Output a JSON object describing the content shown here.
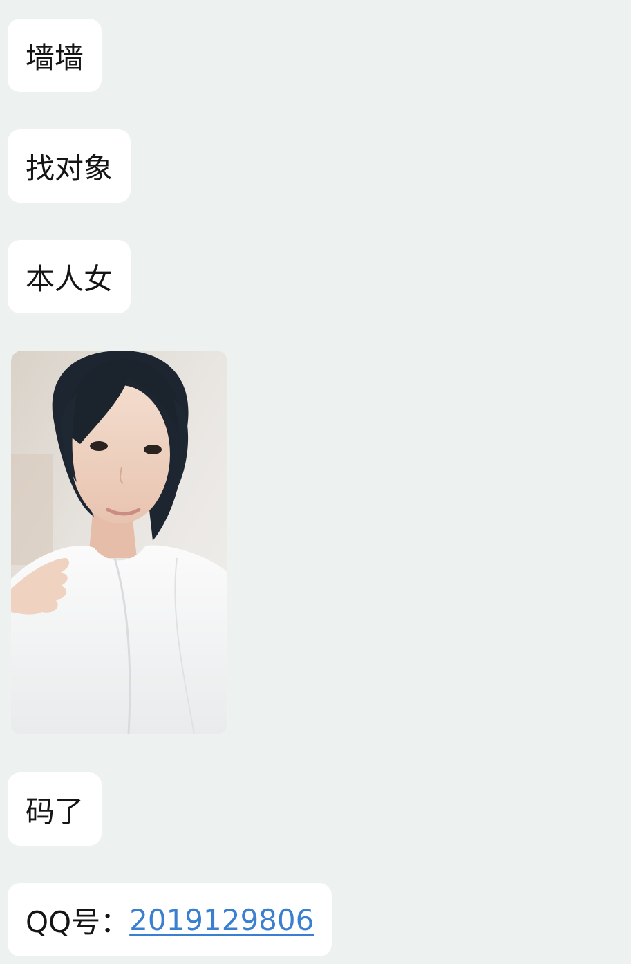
{
  "messages": [
    {
      "text": "墙墙"
    },
    {
      "text": "找对象"
    },
    {
      "text": "本人女"
    },
    {
      "text": "码了"
    }
  ],
  "qq": {
    "label": "QQ号：",
    "number": "2019129806",
    "link_color": "#3b7fd1"
  },
  "photo": {
    "icon": "photo-of-person"
  },
  "theme": {
    "background": "#edf1ef",
    "bubble": "#ffffff",
    "text": "#151515"
  }
}
